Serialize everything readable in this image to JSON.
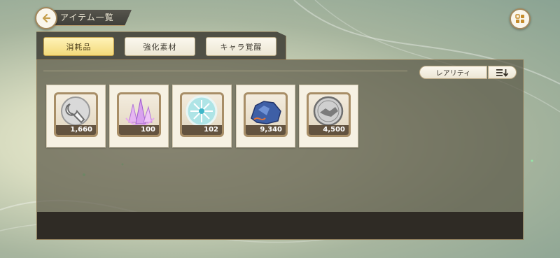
{
  "header": {
    "title": "アイテム一覧",
    "back_icon": "back-arrow-icon",
    "menu_icon": "menu-grid-icon"
  },
  "tabs": [
    {
      "label": "消耗品",
      "active": true
    },
    {
      "label": "強化素材",
      "active": false
    },
    {
      "label": "キャラ覚醒",
      "active": false
    }
  ],
  "sort": {
    "rarity_label": "レアリティ",
    "order_icon": "sort-descending-icon"
  },
  "items": [
    {
      "icon": "wrench-icon",
      "count": "1,660"
    },
    {
      "icon": "crystal-icon",
      "count": "100"
    },
    {
      "icon": "snowflake-medal-icon",
      "count": "102"
    },
    {
      "icon": "blue-ore-icon",
      "count": "9,340"
    },
    {
      "icon": "handshake-coin-icon",
      "count": "4,500"
    }
  ],
  "colors": {
    "accent": "#f3d97a",
    "frame": "#a88e67",
    "panel": "#5c5948"
  }
}
